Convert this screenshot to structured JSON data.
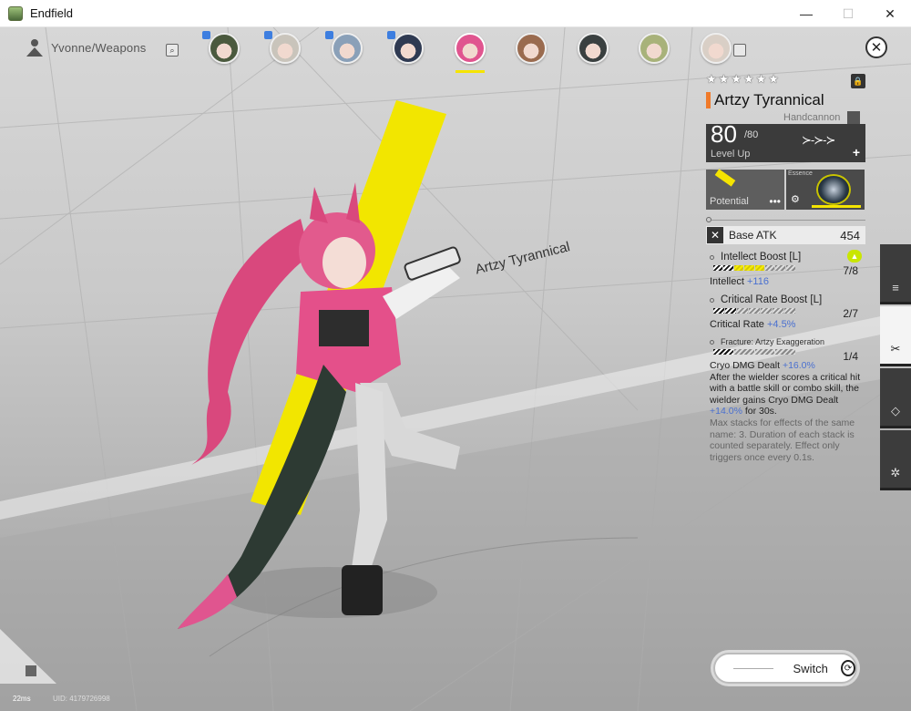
{
  "window": {
    "title": "Endfield",
    "minimize": "—",
    "maximize": "☐",
    "close": "✕"
  },
  "top": {
    "breadcrumb": "Yvonne/Weapons",
    "search_glyph": "⌕",
    "close_glyph": "✕",
    "roster": [
      {
        "name": "operator-1",
        "color": "#4b5a3e",
        "badge": true,
        "selected": false
      },
      {
        "name": "operator-2",
        "color": "#c9c4bb",
        "badge": true,
        "selected": false
      },
      {
        "name": "operator-3",
        "color": "#8aa0b8",
        "badge": true,
        "selected": false
      },
      {
        "name": "operator-4",
        "color": "#2f3a52",
        "badge": true,
        "selected": false
      },
      {
        "name": "yvonne",
        "color": "#e0558f",
        "badge": false,
        "selected": true
      },
      {
        "name": "operator-6",
        "color": "#9a6b4f",
        "badge": false,
        "selected": false
      },
      {
        "name": "operator-7",
        "color": "#3a4040",
        "badge": false,
        "selected": false
      },
      {
        "name": "operator-8",
        "color": "#a8b27a",
        "badge": false,
        "selected": false
      },
      {
        "name": "operator-9",
        "color": "#d9cfc6",
        "badge": false,
        "selected": false
      }
    ]
  },
  "weapon": {
    "stars": [
      "★",
      "★",
      "★",
      "★",
      "★",
      "★"
    ],
    "lock_glyph": "🔒",
    "name": "Artzy Tyrannical",
    "type": "Handcannon",
    "level": "80",
    "level_max": "/80",
    "level_up_label": "Level Up",
    "level_arrows": "≻-≻-≻",
    "level_plus": "+",
    "potential_label": "Potential",
    "potential_more": "•••",
    "essence_tag": "Essence",
    "essence_gear": "⚙",
    "base_atk_label": "Base ATK",
    "base_atk_value": "454"
  },
  "skills": [
    {
      "name": "Intellect Boost [L]",
      "level": "7/8",
      "stat_label": "Intellect",
      "stat_value": "+116",
      "segments": [
        "on",
        "on",
        "yel",
        "yel",
        "yel",
        "off",
        "off",
        "off"
      ],
      "badge": true
    },
    {
      "name": "Critical Rate Boost [L]",
      "level": "2/7",
      "stat_label": "Critical Rate",
      "stat_value": "+4.5%",
      "segments": [
        "on",
        "on",
        "off",
        "off",
        "off",
        "off",
        "off"
      ],
      "badge": false
    }
  ],
  "fracture": {
    "name": "Fracture: Artzy Exaggeration",
    "level": "1/4",
    "stat_label": "Cryo DMG Dealt",
    "stat_value": "+16.0%",
    "desc_1": "After the wielder scores a critical hit with a battle skill or combo skill, the wielder gains Cryo DMG Dealt ",
    "desc_val": "+14.0%",
    "desc_2": " for 30s.",
    "desc_muted": "Max stacks for effects of the same name: 3. Duration of each stack is counted separately. Effect only triggers once every 0.1s."
  },
  "side_tabs": [
    "≡",
    "✂",
    "◇",
    "✲"
  ],
  "scene": {
    "label": "Artzy Tyrannical"
  },
  "bottom": {
    "switch_label": "Switch",
    "switch_glyph": "⟳",
    "ping": "22ms",
    "uid": "UID: 4179726998"
  },
  "colors": {
    "accent_yellow": "#f5e400",
    "name_orange": "#f07a2a",
    "stat_blue": "#4a70d0",
    "hair_pink": "#e0558f"
  }
}
